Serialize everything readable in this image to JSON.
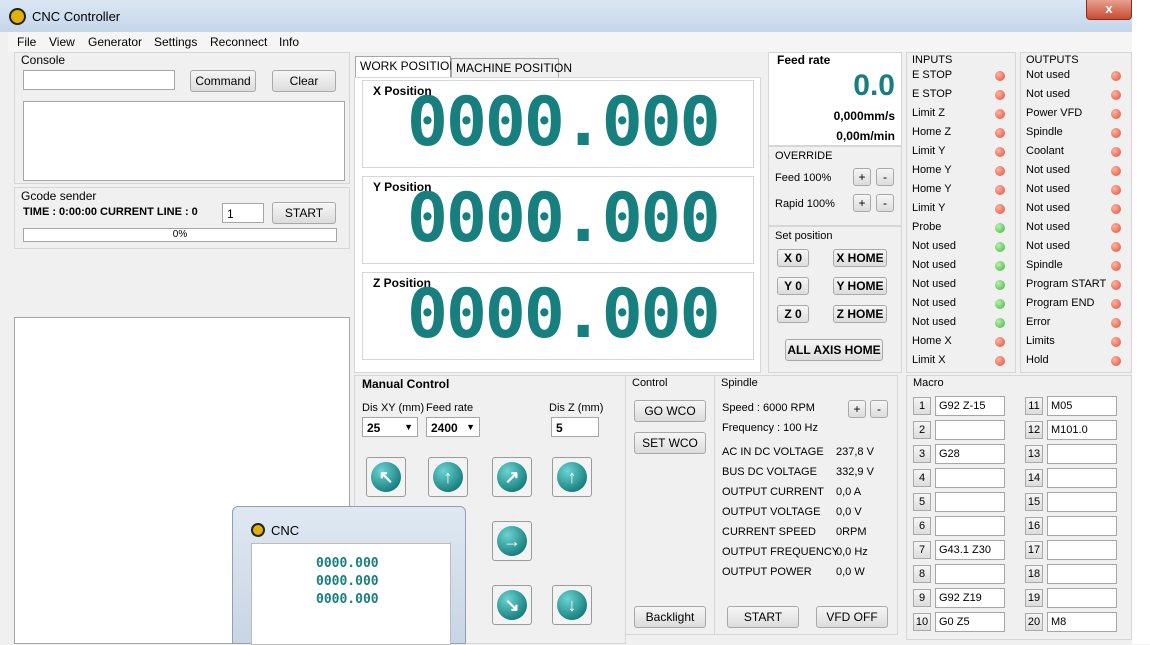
{
  "window": {
    "title": "CNC Controller",
    "close_glyph": "x"
  },
  "menu": [
    "File",
    "View",
    "Generator",
    "Settings",
    "Reconnect",
    "Info"
  ],
  "console": {
    "label": "Console",
    "command_label": "Command",
    "clear_label": "Clear"
  },
  "gcode": {
    "label": "Gcode sender",
    "time_line": "TIME : 0:00:00 CURRENT LINE : 0",
    "line_value": "1",
    "start_label": "START",
    "progress": "0%"
  },
  "positions": {
    "tabs": [
      "WORK POSITION",
      "MACHINE POSITION"
    ],
    "x_label": "X Position",
    "x_value": "0000.000",
    "y_label": "Y Position",
    "y_value": "0000.000",
    "z_label": "Z Position",
    "z_value": "0000.000"
  },
  "feed": {
    "label": "Feed rate",
    "value": "0.0",
    "mms": "0,000mm/s",
    "mmin": "0,00m/min"
  },
  "override": {
    "label": "OVERRIDE",
    "feed": "Feed 100%",
    "rapid": "Rapid 100%",
    "plus": "+",
    "minus": "-"
  },
  "setpos": {
    "label": "Set position",
    "x0": "X 0",
    "y0": "Y 0",
    "z0": "Z 0",
    "xhome": "X HOME",
    "yhome": "Y HOME",
    "zhome": "Z HOME",
    "allhome": "ALL AXIS HOME"
  },
  "inputs": {
    "label": "INPUTS",
    "items": [
      {
        "name": "E STOP",
        "state": "red"
      },
      {
        "name": "E STOP",
        "state": "red"
      },
      {
        "name": "Limit Z",
        "state": "red"
      },
      {
        "name": "Home Z",
        "state": "red"
      },
      {
        "name": "Limit Y",
        "state": "red"
      },
      {
        "name": "Home Y",
        "state": "red"
      },
      {
        "name": "Home Y",
        "state": "red"
      },
      {
        "name": "Limit Y",
        "state": "red"
      },
      {
        "name": "Probe",
        "state": "green"
      },
      {
        "name": "Not used",
        "state": "green"
      },
      {
        "name": "Not used",
        "state": "green"
      },
      {
        "name": "Not used",
        "state": "green"
      },
      {
        "name": "Not used",
        "state": "green"
      },
      {
        "name": "Not used",
        "state": "green"
      },
      {
        "name": "Home X",
        "state": "red"
      },
      {
        "name": "Limit X",
        "state": "red"
      }
    ]
  },
  "outputs": {
    "label": "OUTPUTS",
    "items": [
      {
        "name": "Not used",
        "state": "red"
      },
      {
        "name": "Not used",
        "state": "red"
      },
      {
        "name": "Power VFD",
        "state": "red"
      },
      {
        "name": "Spindle",
        "state": "red"
      },
      {
        "name": "Coolant",
        "state": "red"
      },
      {
        "name": "Not used",
        "state": "red"
      },
      {
        "name": "Not used",
        "state": "red"
      },
      {
        "name": "Not used",
        "state": "red"
      },
      {
        "name": "Not used",
        "state": "red"
      },
      {
        "name": "Not used",
        "state": "red"
      },
      {
        "name": "Spindle",
        "state": "red"
      },
      {
        "name": "Program START",
        "state": "red"
      },
      {
        "name": "Program END",
        "state": "red"
      },
      {
        "name": "Error",
        "state": "red"
      },
      {
        "name": "Limits",
        "state": "red"
      },
      {
        "name": "Hold",
        "state": "red"
      }
    ]
  },
  "manual": {
    "label": "Manual Control",
    "dis_xy_label": "Dis XY (mm)",
    "dis_xy": "25",
    "feed_label": "Feed rate",
    "feed": "2400",
    "dis_z_label": "Dis Z (mm)",
    "dis_z": "5"
  },
  "control": {
    "label": "Control",
    "go_wco": "GO WCO",
    "set_wco": "SET WCO",
    "backlight": "Backlight"
  },
  "spindle": {
    "label": "Spindle",
    "speed": "Speed : 6000 RPM",
    "frequency": "Frequency : 100 Hz",
    "rows": [
      {
        "k": "AC IN DC VOLTAGE",
        "v": "237,8 V"
      },
      {
        "k": "BUS DC VOLTAGE",
        "v": "332,9 V"
      },
      {
        "k": "OUTPUT CURRENT",
        "v": "0,0 A"
      },
      {
        "k": "OUTPUT VOLTAGE",
        "v": "0,0 V"
      },
      {
        "k": "CURRENT SPEED",
        "v": "0RPM"
      },
      {
        "k": "OUTPUT FREQUENCY",
        "v": "0,0 Hz"
      },
      {
        "k": "OUTPUT POWER",
        "v": "0,0 W"
      }
    ],
    "start": "START",
    "vfd_off": "VFD OFF"
  },
  "macro": {
    "label": "Macro",
    "items": [
      {
        "n": "1",
        "v": "G92 Z-15"
      },
      {
        "n": "2",
        "v": ""
      },
      {
        "n": "3",
        "v": "G28"
      },
      {
        "n": "4",
        "v": ""
      },
      {
        "n": "5",
        "v": ""
      },
      {
        "n": "6",
        "v": ""
      },
      {
        "n": "7",
        "v": "G43.1 Z30"
      },
      {
        "n": "8",
        "v": ""
      },
      {
        "n": "9",
        "v": "G92 Z19"
      },
      {
        "n": "10",
        "v": "G0 Z5"
      },
      {
        "n": "11",
        "v": "M05"
      },
      {
        "n": "12",
        "v": "M101.0"
      },
      {
        "n": "13",
        "v": ""
      },
      {
        "n": "14",
        "v": ""
      },
      {
        "n": "15",
        "v": ""
      },
      {
        "n": "16",
        "v": ""
      },
      {
        "n": "17",
        "v": ""
      },
      {
        "n": "18",
        "v": ""
      },
      {
        "n": "19",
        "v": ""
      },
      {
        "n": "20",
        "v": "M8"
      }
    ]
  },
  "thumbnail": {
    "title": "CNC",
    "digits": "0000.000"
  },
  "colors": {
    "digits": "#177f7e",
    "led_red": "#e24d30",
    "led_green": "#3fb53a"
  }
}
